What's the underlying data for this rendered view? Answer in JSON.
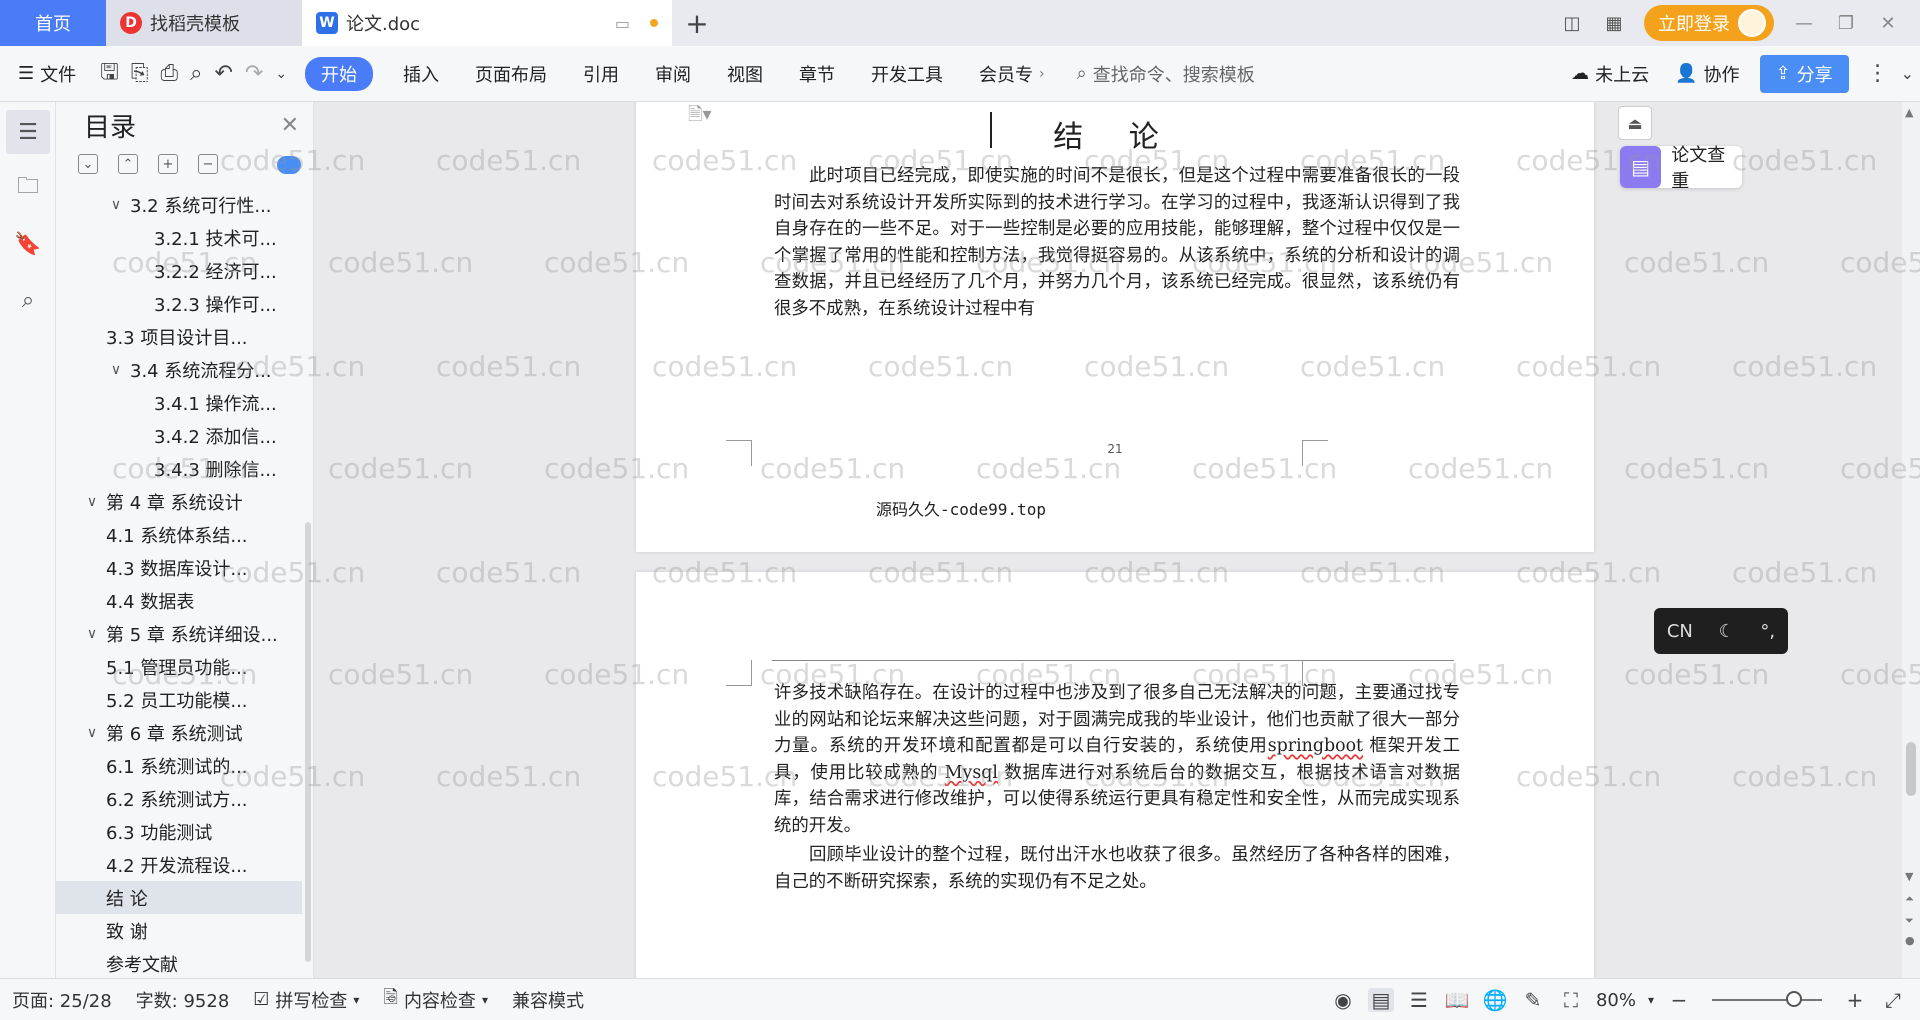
{
  "tabs": {
    "home": "首页",
    "tab1": "找稻壳模板",
    "tab2": "论文.doc",
    "login": "立即登录"
  },
  "ribbon": {
    "file": "文件",
    "menus": [
      "开始",
      "插入",
      "页面布局",
      "引用",
      "审阅",
      "视图",
      "章节",
      "开发工具",
      "会员专"
    ],
    "search_placeholder": "查找命令、搜索模板",
    "cloud": "未上云",
    "collab": "协作",
    "share": "分享"
  },
  "outline": {
    "title": "目录",
    "items": [
      {
        "label": "3.2 系统可行性...",
        "level": "l2",
        "chev": "∨"
      },
      {
        "label": "3.2.1 技术可...",
        "level": "l3"
      },
      {
        "label": "3.2.2 经济可...",
        "level": "l3"
      },
      {
        "label": "3.2.3 操作可...",
        "level": "l3"
      },
      {
        "label": "3.3 项目设计目...",
        "level": "l1n"
      },
      {
        "label": "3.4 系统流程分...",
        "level": "l2",
        "chev": "∨"
      },
      {
        "label": "3.4.1 操作流...",
        "level": "l3"
      },
      {
        "label": "3.4.2 添加信...",
        "level": "l3"
      },
      {
        "label": "3.4.3 删除信...",
        "level": "l3"
      },
      {
        "label": "第 4 章  系统设计",
        "level": "l1",
        "chev": "∨"
      },
      {
        "label": "4.1  系统体系结...",
        "level": "l1n"
      },
      {
        "label": "4.3  数据库设计...",
        "level": "l1n"
      },
      {
        "label": "4.4  数据表",
        "level": "l1n"
      },
      {
        "label": "第 5 章  系统详细设...",
        "level": "l1",
        "chev": "∨"
      },
      {
        "label": "5.1 管理员功能...",
        "level": "l1n"
      },
      {
        "label": "5.2 员工功能模...",
        "level": "l1n"
      },
      {
        "label": "第 6 章    系统测试",
        "level": "l1",
        "chev": "∨"
      },
      {
        "label": "6.1 系统测试的...",
        "level": "l1n"
      },
      {
        "label": "6.2 系统测试方...",
        "level": "l1n"
      },
      {
        "label": "6.3 功能测试",
        "level": "l1n"
      },
      {
        "label": "4.2 开发流程设...",
        "level": "l1n"
      },
      {
        "label": "结    论",
        "level": "l1x",
        "selected": true
      },
      {
        "label": "致    谢",
        "level": "l1x"
      },
      {
        "label": "参考文献",
        "level": "l1x"
      }
    ]
  },
  "document": {
    "heading": "结  论",
    "page1_para": "此时项目已经完成，即使实施的时间不是很长，但是这个过程中需要准备很长的一段时间去对系统设计开发所实际到的技术进行学习。在学习的过程中，我逐渐认识得到了我自身存在的一些不足。对于一些控制是必要的应用技能，能够理解，整个过程中仅仅是一个掌握了常用的性能和控制方法，我觉得挺容易的。从该系统中，系统的分析和设计的调查数据，并且已经经历了几个月，并努力几个月，该系统已经完成。很显然，该系统仍有很多不成熟，在系统设计过程中有",
    "page_number": "21",
    "footer": "源码久久-code99.top",
    "page2_para1_a": "许多技术缺陷存在。在设计的过程中也涉及到了很多自己无法解决的问题，主要通过找专业的网站和论坛来解决这些问题，对于圆满完成我的毕业设计，他们也贡献了很大一部分力量。系统的开发环境和配置都是可以自行安装的，系统使用",
    "page2_springboot": "springboot",
    "page2_para1_b": " 框架开发工具，使用比较成熟的 ",
    "page2_mysql": "Mysql",
    "page2_para1_c": " 数据库进行对系统后台的数据交互，根据技术语言对数据库，结合需求进行修改维护，可以使得系统运行更具有稳定性和安全性，从而完成实现系统的开发。",
    "page2_para2": "回顾毕业设计的整个过程，既付出汗水也收获了很多。虽然经历了各种各样的困难，自己的不断研究探索，系统的实现仍有不足之处。"
  },
  "side": {
    "check": "论文查重",
    "ime_cn": "CN"
  },
  "watermark": "code51.cn",
  "status": {
    "page": "页面: 25/28",
    "words": "字数: 9528",
    "spell": "拼写检查",
    "content_check": "内容检查",
    "compat": "兼容模式",
    "zoom": "80%"
  },
  "colors": {
    "accent": "#4a7cf7",
    "login": "#f4a21c",
    "check_icon": "#8c7bf0"
  }
}
